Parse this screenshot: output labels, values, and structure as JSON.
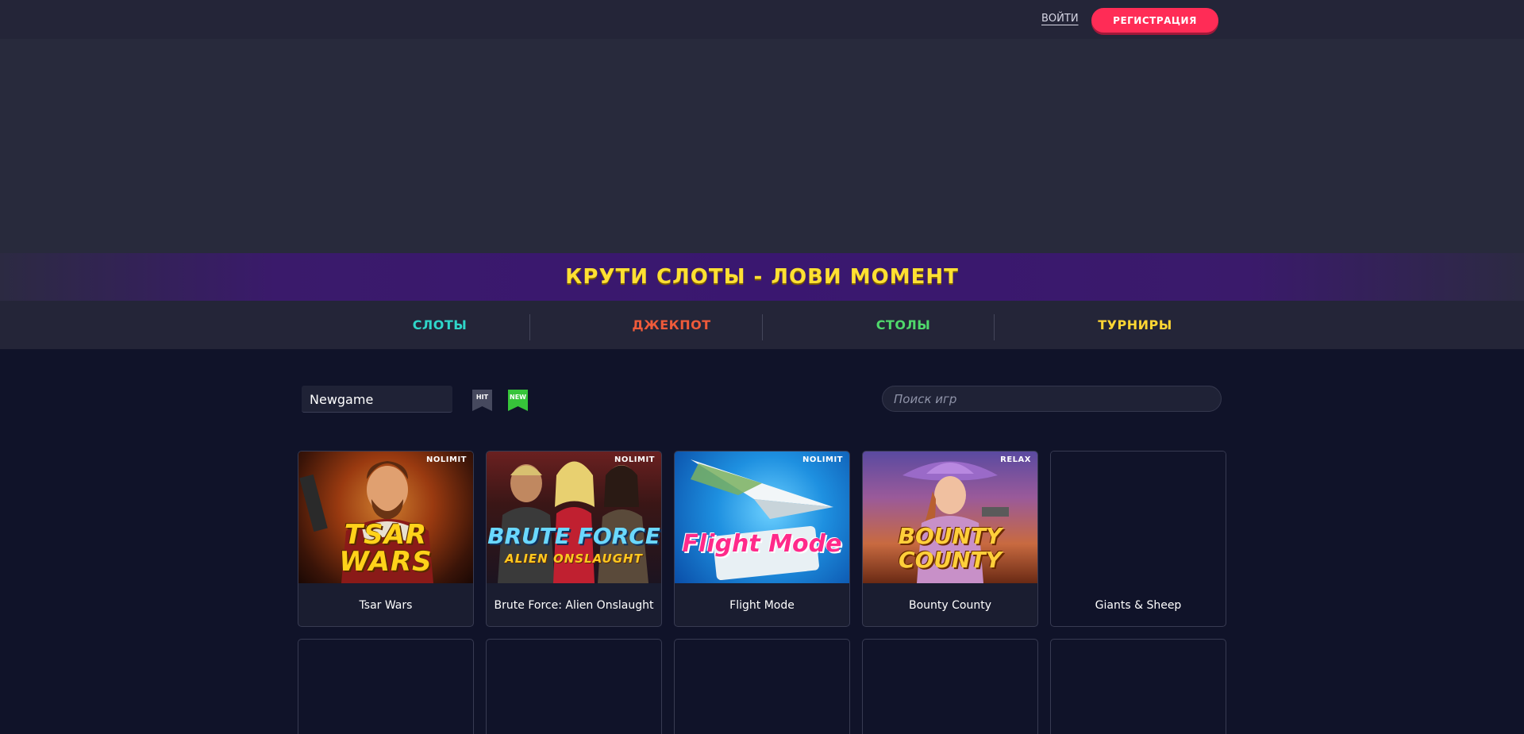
{
  "header": {
    "login_label": "ВОЙТИ",
    "register_label": "РЕГИСТРАЦИЯ"
  },
  "promo": {
    "text": "КРУТИ СЛОТЫ - ЛОВИ МОМЕНТ"
  },
  "categories": [
    {
      "label": "СЛОТЫ",
      "color": "#2fd6c9"
    },
    {
      "label": "ДЖЕКПОТ",
      "color": "#ee5a3a"
    },
    {
      "label": "СТОЛЫ",
      "color": "#4fd86b"
    },
    {
      "label": "ТУРНИРЫ",
      "color": "#ffd633"
    }
  ],
  "filters": {
    "provider_value": "Newgame",
    "hit_badge": "HIT",
    "new_badge": "NEW",
    "search_placeholder": "Поиск игр"
  },
  "games": [
    {
      "title": "Tsar Wars",
      "provider": "NOLIMIT",
      "art": "TSAR WARS",
      "icon": "tsar-wars-art"
    },
    {
      "title": "Brute Force: Alien Onslaught",
      "provider": "NOLIMIT",
      "art": "BRUTE FORCE",
      "art_sub": "ALIEN ONSLAUGHT",
      "icon": "brute-force-art"
    },
    {
      "title": "Flight Mode",
      "provider": "NOLIMIT",
      "art": "Flight Mode",
      "icon": "flight-mode-art"
    },
    {
      "title": "Bounty County",
      "provider": "RELAX",
      "art": "BOUNTY COUNTY",
      "icon": "bounty-county-art"
    },
    {
      "title": "Giants & Sheep",
      "provider": "",
      "art": "",
      "icon": ""
    }
  ],
  "colors": {
    "accent": "#ff2c56",
    "promo_text": "#ffe033",
    "background": "#101329"
  }
}
